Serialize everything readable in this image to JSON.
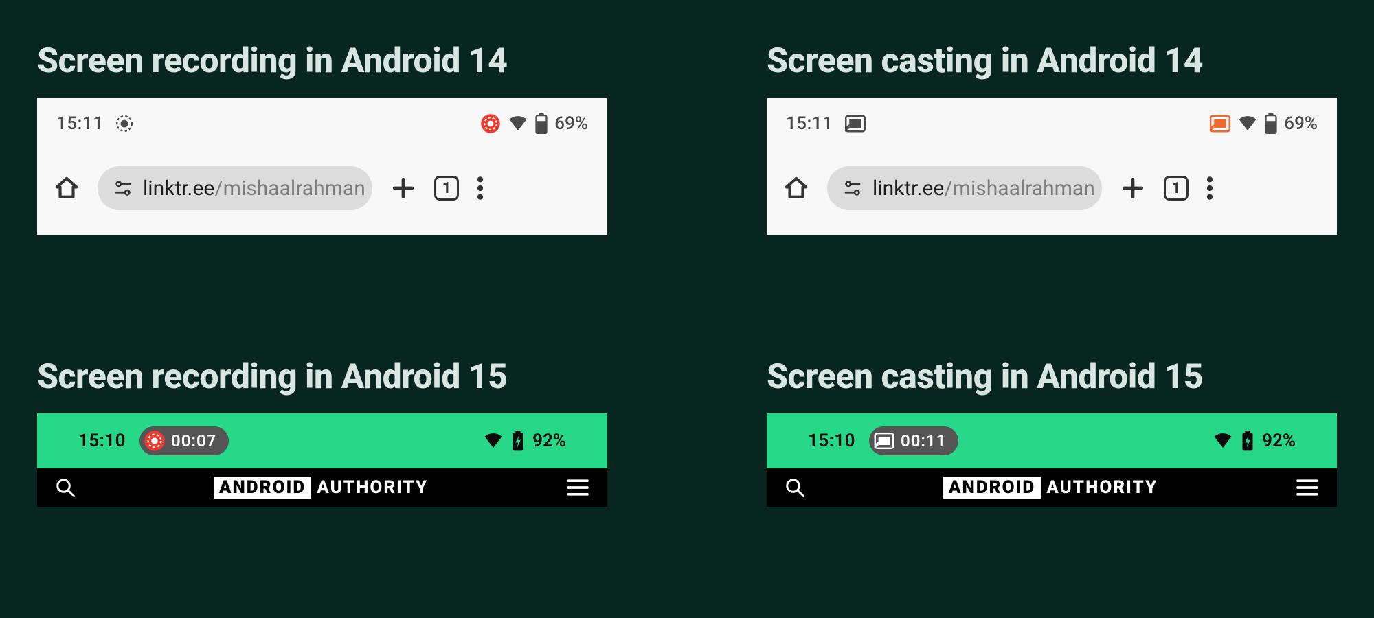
{
  "colors": {
    "bg": "#06261f",
    "heading": "#d9e5e0",
    "a14_bg": "#f8f8f8",
    "url_pill": "#dcdcdc",
    "a15_green": "#28d889",
    "chip_bg": "#555555",
    "record_red": "#ee3b2f",
    "cast_orange": "#ee6a2f"
  },
  "panels": {
    "rec14": {
      "heading": "Screen recording in Android 14",
      "time": "15:11",
      "battery": "69%",
      "url_host": "linktr.ee",
      "url_path": "/mishaalrahman",
      "tab_count": "1"
    },
    "cast14": {
      "heading": "Screen casting in Android 14",
      "time": "15:11",
      "battery": "69%",
      "url_host": "linktr.ee",
      "url_path": "/mishaalrahman",
      "tab_count": "1"
    },
    "rec15": {
      "heading": "Screen recording in Android 15",
      "time": "15:10",
      "chip_timer": "00:07",
      "battery": "92%",
      "logo_box": "ANDROID",
      "logo_rest": "AUTHORITY"
    },
    "cast15": {
      "heading": "Screen casting in Android 15",
      "time": "15:10",
      "chip_timer": "00:11",
      "battery": "92%",
      "logo_box": "ANDROID",
      "logo_rest": "AUTHORITY"
    }
  }
}
